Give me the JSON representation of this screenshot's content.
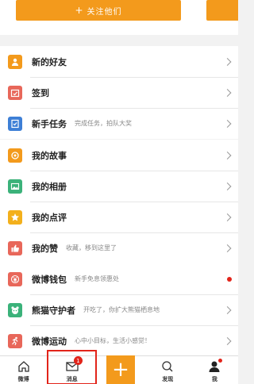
{
  "top": {
    "follow_label": "关注他们",
    "plus": "+"
  },
  "group1": [
    {
      "label": "新的好友",
      "sub": "",
      "icon": "friend-icon",
      "color": "#f39a1c"
    },
    {
      "label": "签到",
      "sub": "",
      "icon": "calendar-icon",
      "color": "#e8675a"
    },
    {
      "label": "新手任务",
      "sub": "完成任务，拍队大奖",
      "icon": "checklist-icon",
      "color": "#3d7fd6"
    }
  ],
  "group2": [
    {
      "label": "我的故事",
      "sub": "",
      "icon": "story-icon",
      "color": "#f39a1c"
    },
    {
      "label": "我的相册",
      "sub": "",
      "icon": "photo-icon",
      "color": "#3bb27a"
    },
    {
      "label": "我的点评",
      "sub": "",
      "icon": "star-icon",
      "color": "#f3b01c"
    },
    {
      "label": "我的赞",
      "sub": "收藏，移到这里了",
      "icon": "thumb-icon",
      "color": "#e8675a"
    }
  ],
  "group3": [
    {
      "label": "微博钱包",
      "sub": "新手免息领惠处",
      "icon": "wallet-icon",
      "color": "#e8675a",
      "dot": true
    },
    {
      "label": "熊猫守护者",
      "sub": "开吃了，你扩大熊猫栖息地",
      "icon": "panda-icon",
      "color": "#3bb27a"
    },
    {
      "label": "微博运动",
      "sub": "心中小目标，生活小感觉！",
      "icon": "run-icon",
      "color": "#e8675a"
    }
  ],
  "tabbar": {
    "home": "微博",
    "messages": "消息",
    "messages_badge": "1",
    "compose": "+",
    "discover": "发现",
    "me": "我"
  },
  "colors": {
    "accent": "#f39a1c",
    "alert": "#e2241a"
  }
}
